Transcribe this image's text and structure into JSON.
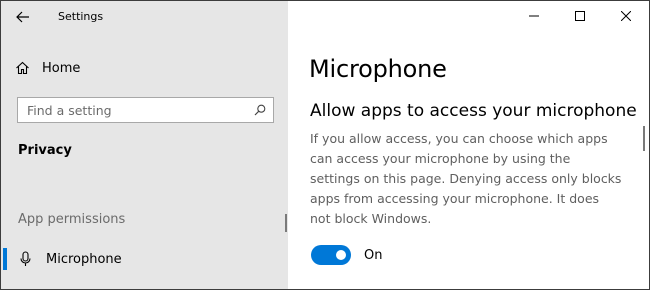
{
  "window": {
    "title": "Settings",
    "controls": {
      "minimize": "minimize",
      "maximize": "maximize",
      "close": "close"
    }
  },
  "sidebar": {
    "home_label": "Home",
    "search": {
      "placeholder": "Find a setting"
    },
    "category": "Privacy",
    "group_label": "App permissions",
    "selected_item": "Microphone"
  },
  "main": {
    "page_title": "Microphone",
    "section_title": "Allow apps to access your microphone",
    "description": "If you allow access, you can choose which apps can access your microphone by using the settings on this page. Denying access only blocks apps from accessing your microphone. It does not block Windows.",
    "toggle": {
      "state": "on",
      "label": "On"
    }
  },
  "colors": {
    "accent": "#0078d7",
    "sidebar_bg": "#e6e6e6"
  },
  "icons": {
    "back": "back-arrow-icon",
    "home": "home-icon",
    "search": "search-icon",
    "microphone": "microphone-icon"
  }
}
